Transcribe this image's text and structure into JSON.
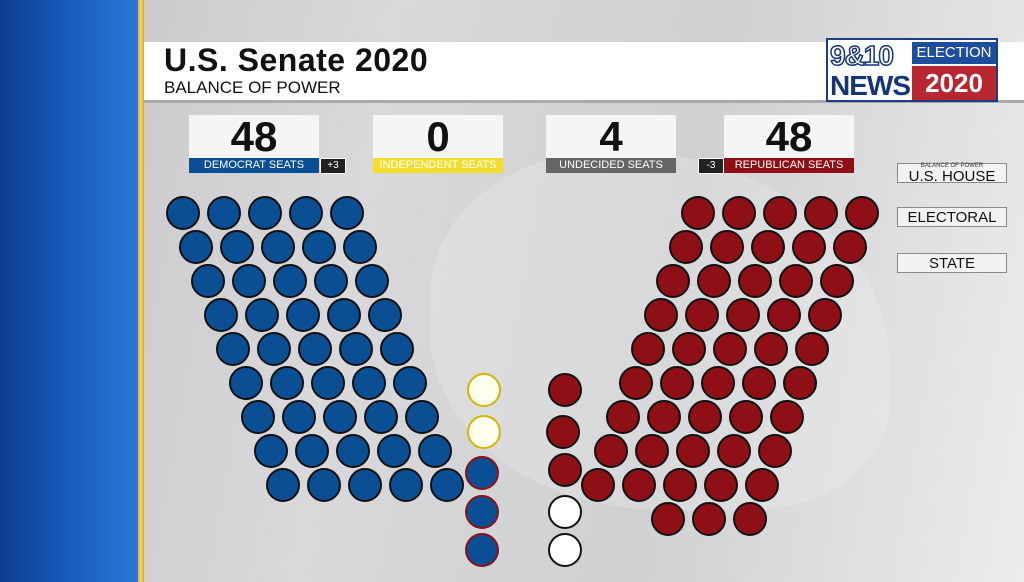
{
  "header": {
    "title": "U.S. Senate 2020",
    "subtitle": "BALANCE OF POWER"
  },
  "logo": {
    "station_line1": "9&10",
    "station_line2": "NEWS",
    "election": "ELECTION",
    "year": "2020"
  },
  "counts": {
    "democrat": {
      "value": "48",
      "label": "DEMOCRAT SEATS",
      "change": "+3",
      "color": "#0a4f94"
    },
    "independent": {
      "value": "0",
      "label": "INDEPENDENT SEATS",
      "color": "#f2dd2a"
    },
    "undecided": {
      "value": "4",
      "label": "UNDECIDED SEATS",
      "color": "#666666"
    },
    "republican": {
      "value": "48",
      "label": "REPUBLICAN SEATS",
      "change": "-3",
      "color": "#8e1016"
    }
  },
  "side_menu": {
    "house_small": "BALANCE OF POWER",
    "house": "U.S. HOUSE",
    "electoral": "ELECTORAL",
    "state": "STATE"
  },
  "seats": {
    "democrat": 48,
    "republican": 48,
    "independent": 0,
    "undecided": 4
  }
}
